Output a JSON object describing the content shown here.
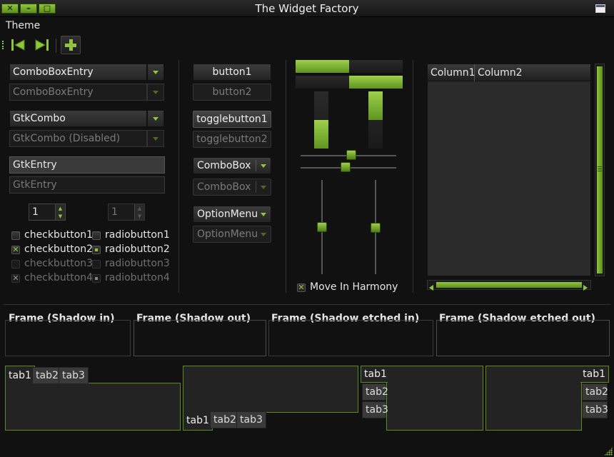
{
  "window": {
    "title": "The Widget Factory"
  },
  "menubar": {
    "theme_label": "Theme"
  },
  "left": {
    "combo_entry_1": "ComboBoxEntry",
    "combo_entry_2": "ComboBoxEntry",
    "gtk_combo_1": "GtkCombo",
    "gtk_combo_2": "GtkCombo (Disabled)",
    "entry_1": "GtkEntry",
    "entry_2": "GtkEntry",
    "spin_1": "1",
    "spin_2": "1",
    "checks": [
      "checkbutton1",
      "checkbutton2",
      "checkbutton3",
      "checkbutton4"
    ],
    "radios": [
      "radiobutton1",
      "radiobutton2",
      "radiobutton3",
      "radiobutton4"
    ],
    "check_mark": "✕"
  },
  "buttons": {
    "button1": "button1",
    "button2": "button2",
    "toggle1": "togglebutton1",
    "toggle2": "togglebutton2",
    "combobox1": "ComboBox",
    "combobox2": "ComboBox",
    "optionmenu1": "OptionMenu",
    "optionmenu2": "OptionMenu"
  },
  "ranges": {
    "hprogress_1": 0.5,
    "hprogress_2": 0.5,
    "vprogress_1": 0.5,
    "vprogress_2": 0.5,
    "hscale_1": 0.5,
    "hscale_2": 0.5,
    "vscale_1": 0.5,
    "vscale_2": 0.5,
    "harmony_label": "Move In Harmony"
  },
  "tree": {
    "col1": "Column1",
    "col2": "Column2"
  },
  "frames": [
    "Frame (Shadow in)",
    "Frame (Shadow out)",
    "Frame (Shadow etched in)",
    "Frame (Shadow etched out)"
  ],
  "notebooks": {
    "tabs": [
      "tab1",
      "tab2",
      "tab3"
    ]
  },
  "colors": {
    "accent": "#8fc63a",
    "background": "#111111"
  }
}
